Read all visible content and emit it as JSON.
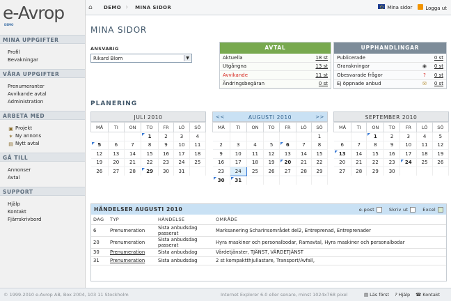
{
  "logo": {
    "text": "e-Avrop",
    "sub": "DEMO"
  },
  "sidebar": [
    {
      "title": "MINA UPPGIFTER",
      "items": [
        {
          "label": "Profil"
        },
        {
          "label": "Bevakningar"
        }
      ]
    },
    {
      "title": "VÅRA UPPGIFTER",
      "items": [
        {
          "label": "Prenumeranter"
        },
        {
          "label": "Avvikande avtal"
        },
        {
          "label": "Administration"
        }
      ]
    },
    {
      "title": "ARBETA MED",
      "items": [
        {
          "label": "Projekt",
          "icon": "folder-icon"
        },
        {
          "label": "Ny annons",
          "icon": "sparkle-icon"
        },
        {
          "label": "Nytt avtal",
          "icon": "document-icon"
        }
      ]
    },
    {
      "title": "GÅ TILL",
      "items": [
        {
          "label": "Annonser"
        },
        {
          "label": "Avtal"
        }
      ]
    },
    {
      "title": "SUPPORT",
      "items": [
        {
          "label": "Hjälp"
        },
        {
          "label": "Kontakt"
        },
        {
          "label": "Fjärrskrivbord"
        }
      ]
    }
  ],
  "breadcrumb": [
    "DEMO",
    "MINA SIDOR"
  ],
  "topnav": {
    "mina": "Mina sidor",
    "logout": "Logga ut"
  },
  "page_title": "MINA SIDOR",
  "ansvarig": {
    "label": "ANSVARIG",
    "value": "Rikard Blom"
  },
  "avtal": {
    "title": "AVTAL",
    "rows": [
      {
        "label": "Aktuella",
        "value": "18 st",
        "color": "#222"
      },
      {
        "label": "Utgångna",
        "value": "13 st",
        "color": "#222"
      },
      {
        "label": "Avvikande",
        "value": "11 st",
        "color": "#d7261e"
      },
      {
        "label": "Ändringsbegäran",
        "value": "0 st",
        "color": "#222"
      }
    ]
  },
  "upphandlingar": {
    "title": "UPPHANDLINGAR",
    "rows": [
      {
        "label": "Publicerade",
        "value": "0 st",
        "icon": ""
      },
      {
        "label": "Granskningar",
        "value": "0 st",
        "icon": "eye-icon"
      },
      {
        "label": "Obesvarade frågor",
        "value": "0 st",
        "icon": "question-icon"
      },
      {
        "label": "Ej öppnade anbud",
        "value": "0 st",
        "icon": "envelope-icon"
      }
    ]
  },
  "planering": "PLANERING",
  "weekdays": [
    "MÅ",
    "TI",
    "ON",
    "TO",
    "FR",
    "LÖ",
    "SÖ"
  ],
  "calendars": [
    {
      "month": "JULI 2010",
      "prev": "",
      "next": "",
      "current": false,
      "weeks": [
        [
          "",
          "",
          "",
          "1",
          "2",
          "3",
          "4"
        ],
        [
          "5",
          "6",
          "7",
          "8",
          "9",
          "10",
          "11"
        ],
        [
          "12",
          "13",
          "14",
          "15",
          "16",
          "17",
          "18"
        ],
        [
          "19",
          "20",
          "21",
          "22",
          "23",
          "24",
          "25"
        ],
        [
          "26",
          "27",
          "28",
          "29",
          "30",
          "31",
          ""
        ]
      ],
      "bold": [
        "1",
        "5",
        "29"
      ],
      "marked": [
        "1",
        "5",
        "29"
      ],
      "today": ""
    },
    {
      "month": "AUGUSTI 2010",
      "prev": "<<",
      "next": ">>",
      "current": true,
      "weeks": [
        [
          "",
          "",
          "",
          "",
          "",
          "",
          "1"
        ],
        [
          "2",
          "3",
          "4",
          "5",
          "6",
          "7",
          "8"
        ],
        [
          "9",
          "10",
          "11",
          "12",
          "13",
          "14",
          "15"
        ],
        [
          "16",
          "17",
          "18",
          "19",
          "20",
          "21",
          "22"
        ],
        [
          "23",
          "24",
          "25",
          "26",
          "27",
          "28",
          "29"
        ],
        [
          "30",
          "31",
          "",
          "",
          "",
          "",
          ""
        ]
      ],
      "bold": [
        "6",
        "20",
        "30",
        "31"
      ],
      "marked": [
        "6",
        "20",
        "30",
        "31"
      ],
      "today": "24"
    },
    {
      "month": "SEPTEMBER 2010",
      "prev": "",
      "next": "",
      "current": false,
      "weeks": [
        [
          "",
          "",
          "1",
          "2",
          "3",
          "4",
          "5"
        ],
        [
          "6",
          "7",
          "8",
          "9",
          "10",
          "11",
          "12"
        ],
        [
          "13",
          "14",
          "15",
          "16",
          "17",
          "18",
          "19"
        ],
        [
          "20",
          "21",
          "22",
          "23",
          "24",
          "25",
          "26"
        ],
        [
          "27",
          "28",
          "29",
          "30",
          "",
          "",
          ""
        ]
      ],
      "bold": [
        "1",
        "13",
        "24"
      ],
      "marked": [
        "1",
        "13",
        "24"
      ],
      "today": ""
    }
  ],
  "events": {
    "title": "HÄNDELSER AUGUSTI 2010",
    "tools": {
      "email": "e-post",
      "print": "Skriv ut",
      "excel": "Excel"
    },
    "headers": [
      "DAG",
      "TYP",
      "HÄNDELSE",
      "OMRÅDE"
    ],
    "rows": [
      {
        "day": "6",
        "type": "Prenumeration",
        "event": "Sista anbudsdag passerat",
        "area": "Marksanering Scharinsområdet del2, Entreprenad, Entreprenader",
        "link": false
      },
      {
        "day": "20",
        "type": "Prenumeration",
        "event": "Sista anbudsdag passerat",
        "area": "Hyra maskiner och personalbodar, Ramavtal, Hyra maskiner och personalbodar",
        "link": false
      },
      {
        "day": "30",
        "type": "Prenumeration",
        "event": "Sista anbudsdag",
        "area": "Värdetjänster, TJÄNST, VÄRDETJÄNST",
        "link": true
      },
      {
        "day": "31",
        "type": "Prenumeration",
        "event": "Sista anbudsdag",
        "area": "2 st kompaktthjullastare, Transport/Avfall,",
        "link": true
      }
    ]
  },
  "footer": {
    "copyright": "© 1999-2010 e-Avrop AB, Box 2004, 103 11 Stockholm",
    "browser": "Internet Explorer 6.0 eller senare, minst 1024x768 pixel",
    "links": [
      "Läs först",
      "Hjälp",
      "Kontakt"
    ]
  }
}
